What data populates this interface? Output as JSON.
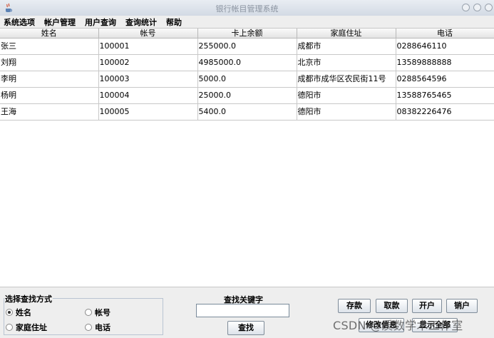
{
  "window": {
    "title": "银行帐目管理系统"
  },
  "menubar": {
    "items": [
      "系统选项",
      "帐户管理",
      "用户查询",
      "查询统计",
      "帮助"
    ]
  },
  "table": {
    "columns": [
      "姓名",
      "帐号",
      "卡上余额",
      "家庭住址",
      "电话"
    ],
    "rows": [
      [
        "张三",
        "100001",
        "255000.0",
        "成都市",
        "0288646110"
      ],
      [
        "刘翔",
        "100002",
        "4985000.0",
        "北京市",
        "13589888888"
      ],
      [
        "李明",
        "100003",
        "5000.0",
        "成都市成华区农民街11号",
        "0288564596"
      ],
      [
        "杨明",
        "100004",
        "25000.0",
        "德阳市",
        "13588765465"
      ],
      [
        "王海",
        "100005",
        "5400.0",
        "德阳市",
        "08382226476"
      ]
    ]
  },
  "search_mode": {
    "title": "选择查找方式",
    "options": [
      "姓名",
      "帐号",
      "家庭住址",
      "电话"
    ],
    "selected": "姓名"
  },
  "keyword": {
    "label": "查找关键字",
    "value": "",
    "search_button": "查找"
  },
  "actions": {
    "deposit": "存款",
    "withdraw": "取款",
    "open_account": "开户",
    "close_account": "销户",
    "modify": "修改信息",
    "show_all": "显示全部"
  },
  "watermark": "CSDN @质数学术工作室"
}
